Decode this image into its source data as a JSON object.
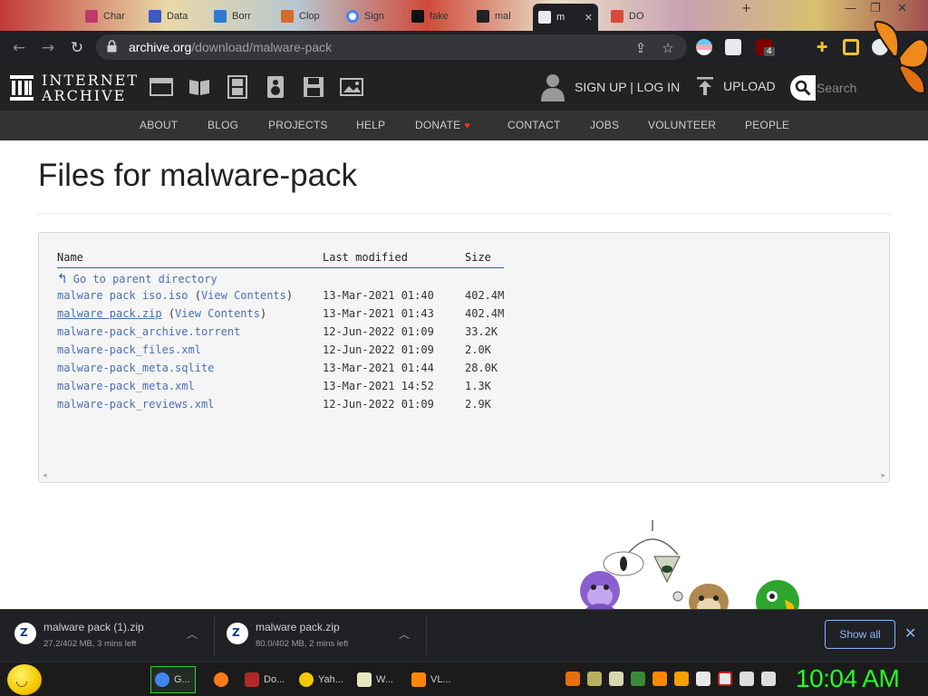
{
  "browser": {
    "tabs": [
      {
        "label": "Char",
        "favicon_color": "#c03a6a"
      },
      {
        "label": "Data",
        "favicon_color": "#3a5bbf"
      },
      {
        "label": "Borr",
        "favicon_color": "#2d7bd1"
      },
      {
        "label": "Clop",
        "favicon_color": "#d66a2a"
      },
      {
        "label": "Sign",
        "favicon_color": "#4285f4"
      },
      {
        "label": "fake",
        "favicon_color": "#111111"
      },
      {
        "label": "mal",
        "favicon_color": "#222222"
      },
      {
        "label": "m",
        "favicon_color": "#e8eaed"
      },
      {
        "label": "DO",
        "favicon_color": "#d94a3a"
      }
    ],
    "active_tab_close": "✕",
    "new_tab": "+",
    "window_controls": [
      "—",
      "❐",
      "✕"
    ],
    "address": {
      "host": "archive.org",
      "path": "/download/malware-pack"
    },
    "extension_badge": "4"
  },
  "ia": {
    "logo_line1": "INTERNET",
    "logo_line2": "ARCHIVE",
    "user_link": "SIGN UP | LOG IN",
    "upload_label": "UPLOAD",
    "search_placeholder": "Search",
    "subnav": [
      "ABOUT",
      "BLOG",
      "PROJECTS",
      "HELP",
      "DONATE",
      "CONTACT",
      "JOBS",
      "VOLUNTEER",
      "PEOPLE"
    ]
  },
  "page": {
    "title": "Files for malware-pack",
    "columns": [
      "Name",
      "Last modified",
      "Size"
    ],
    "parent_link": "Go to parent directory",
    "files": [
      {
        "name": "malware pack iso.iso",
        "extra": "View Contents",
        "modified": "13-Mar-2021 01:40",
        "size": "402.4M"
      },
      {
        "name": "malware pack.zip",
        "extra": "View Contents",
        "modified": "13-Mar-2021 01:43",
        "size": "402.4M"
      },
      {
        "name": "malware-pack_archive.torrent",
        "modified": "12-Jun-2022 01:09",
        "size": "33.2K"
      },
      {
        "name": "malware-pack_files.xml",
        "modified": "12-Jun-2022 01:09",
        "size": "2.0K"
      },
      {
        "name": "malware-pack_meta.sqlite",
        "modified": "13-Mar-2021 01:44",
        "size": "28.0K"
      },
      {
        "name": "malware-pack_meta.xml",
        "modified": "13-Mar-2021 14:52",
        "size": "1.3K"
      },
      {
        "name": "malware-pack_reviews.xml",
        "modified": "12-Jun-2022 01:09",
        "size": "2.9K"
      }
    ]
  },
  "downloads": {
    "items": [
      {
        "name": "malware pack (1).zip",
        "progress": "27.2/402 MB, 3 mins left"
      },
      {
        "name": "malware pack.zip",
        "progress": "80.0/402 MB, 2 mins left"
      }
    ],
    "show_all": "Show all",
    "close": "✕"
  },
  "taskbar": {
    "tasks": [
      {
        "label": "G...",
        "icon_color": "#4285f4"
      },
      {
        "label": "",
        "icon_color": "#ff7a18"
      },
      {
        "label": "Do...",
        "icon_color": "#b02a2a"
      },
      {
        "label": "Yah...",
        "icon_color": "#f3c800"
      },
      {
        "label": "W...",
        "icon_color": "#e8e8c0"
      },
      {
        "label": "VL...",
        "icon_color": "#ff8800"
      }
    ],
    "clock": "10:04 AM"
  },
  "colors": {
    "link": "#4a6fb5",
    "clock": "#24ff24",
    "accent_blue": "#8ab4f8"
  }
}
